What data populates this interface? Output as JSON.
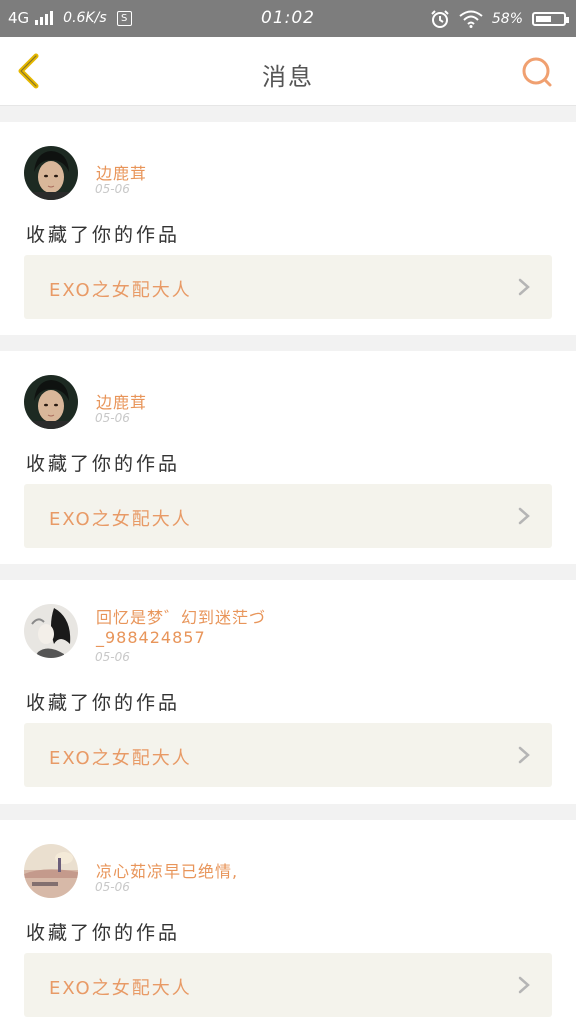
{
  "status_bar": {
    "network": "4G",
    "speed": "0.6K/s",
    "box_label": "S",
    "time": "01:02",
    "battery": "58%",
    "battery_level": 0.58
  },
  "nav": {
    "title": "消息"
  },
  "messages": [
    {
      "username": "边鹿茸",
      "date": "05-06",
      "action": "收藏了你的作品",
      "work_title": "EXO之女配大人",
      "avatar": "boy-portrait"
    },
    {
      "username": "边鹿茸",
      "date": "05-06",
      "action": "收藏了你的作品",
      "work_title": "EXO之女配大人",
      "avatar": "boy-portrait"
    },
    {
      "username": "回忆是梦゛幻到迷茫づ",
      "username_line2": "_988424857",
      "date": "05-06",
      "action": "收藏了你的作品",
      "work_title": "EXO之女配大人",
      "avatar": "ink-figure"
    },
    {
      "username": "凉心茹凉早已绝情,",
      "date": "05-06",
      "action": "收藏了你的作品",
      "work_title": "EXO之女配大人",
      "avatar": "landscape"
    }
  ],
  "colors": {
    "accent": "#e8955a",
    "back_icon": "#e6b800",
    "status_bar": "#7d7d7d",
    "link_bg": "#f4f3ec"
  }
}
